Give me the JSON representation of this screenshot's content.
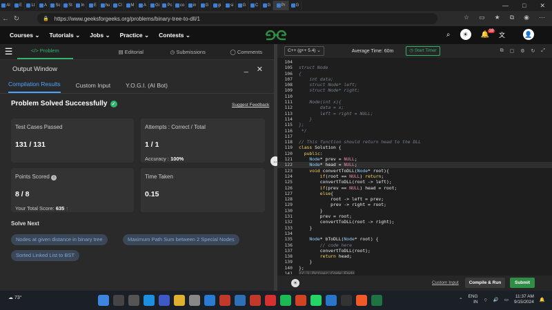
{
  "browser": {
    "tabs": [
      "Al",
      "E",
      "Lt",
      "A",
      "Sc",
      "St",
      "In",
      "E",
      "hu",
      "Cl",
      "M",
      "A",
      "Gi",
      "Pc",
      "co",
      "in",
      "G",
      "gi",
      "si",
      "G",
      "C",
      "G",
      "Pr",
      "G"
    ],
    "active_tab": "Pr",
    "url": "https://www.geeksforgeeks.org/problems/binary-tree-to-dll/1"
  },
  "site_nav": {
    "items": [
      "Courses",
      "Tutorials",
      "Jobs",
      "Practice",
      "Contests"
    ],
    "notification_count": "18"
  },
  "problem_tabs": [
    "Problem",
    "Editorial",
    "Submissions",
    "Comments"
  ],
  "output": {
    "title": "Output Window",
    "tabs": [
      "Compilation Results",
      "Custom Input",
      "Y.O.G.I. (AI Bot)"
    ],
    "status": "Problem Solved Successfully",
    "feedback": "Suggest Feedback",
    "test_cases_label": "Test Cases Passed",
    "test_cases_value": "131 / 131",
    "attempts_label": "Attempts : Correct / Total",
    "attempts_value": "1 / 1",
    "accuracy_label": "Accuracy :",
    "accuracy_value": "100%",
    "points_label": "Points Scored",
    "points_value": "8 / 8",
    "total_score_label": "Your Total Score:",
    "total_score_value": "635",
    "time_label": "Time Taken",
    "time_value": "0.15",
    "solve_next_title": "Solve Next",
    "solve_next": [
      "Nodes at given distance in binary tree",
      "Maximum Path Sum between 2 Special Nodes",
      "Sorted Linked List to BST"
    ]
  },
  "editor": {
    "language": "C++ (g++ 5.4)",
    "average_time": "Average Time: 60m",
    "timer": "Start Timer",
    "custom_input": "Custom Input",
    "compile_run": "Compile & Run",
    "submit": "Submit",
    "lines": [
      {
        "n": "104",
        "code": ""
      },
      {
        "n": "105",
        "code": "struct Node"
      },
      {
        "n": "106",
        "code": "{"
      },
      {
        "n": "107",
        "code": "    int data;"
      },
      {
        "n": "108",
        "code": "    struct Node* left;"
      },
      {
        "n": "109",
        "code": "    struct Node* right;"
      },
      {
        "n": "110",
        "code": ""
      },
      {
        "n": "111",
        "code": "    Node(int x){"
      },
      {
        "n": "112",
        "code": "        data = x;"
      },
      {
        "n": "113",
        "code": "        left = right = NULL;"
      },
      {
        "n": "114",
        "code": "    }"
      },
      {
        "n": "115",
        "code": "};"
      },
      {
        "n": "116",
        "code": " */"
      },
      {
        "n": "117",
        "code": ""
      },
      {
        "n": "118",
        "code": "// This function should return head to the DLL"
      },
      {
        "n": "119",
        "code": "class Solution {"
      },
      {
        "n": "120",
        "code": "  public:"
      },
      {
        "n": "121",
        "code": "    Node* prev = NULL;"
      },
      {
        "n": "122",
        "code": "    Node* head = NULL;"
      },
      {
        "n": "123",
        "code": "    void convertToDLL(Node* root){"
      },
      {
        "n": "124",
        "code": "        if(root == NULL) return;"
      },
      {
        "n": "125",
        "code": "        convertToDLL(root -> left);"
      },
      {
        "n": "126",
        "code": "        if(prev == NULL) head = root;"
      },
      {
        "n": "127",
        "code": "        else{"
      },
      {
        "n": "128",
        "code": "            root -> left = prev;"
      },
      {
        "n": "129",
        "code": "            prev -> right = root;"
      },
      {
        "n": "130",
        "code": "        }"
      },
      {
        "n": "131",
        "code": "        prev = root;"
      },
      {
        "n": "132",
        "code": "        convertToDLL(root -> right);"
      },
      {
        "n": "133",
        "code": "    }"
      },
      {
        "n": "134",
        "code": ""
      },
      {
        "n": "135",
        "code": "    Node* bToDLL(Node* root) {"
      },
      {
        "n": "136",
        "code": "        // code here"
      },
      {
        "n": "137",
        "code": "        convertToDLL(root);"
      },
      {
        "n": "138",
        "code": "        return head;"
      },
      {
        "n": "139",
        "code": "    }"
      },
      {
        "n": "140",
        "code": "};"
      },
      {
        "n": "141",
        "code": "// } Driver Code Ends"
      }
    ]
  },
  "taskbar": {
    "temperature": "73°",
    "lang": "ENG",
    "lang2": "IN",
    "time": "11:37 AM",
    "date": "9/15/2024"
  },
  "colors": {
    "accent_green": "#2f8d46",
    "link_blue": "#4da3ff",
    "check_green": "#2fb56b"
  }
}
